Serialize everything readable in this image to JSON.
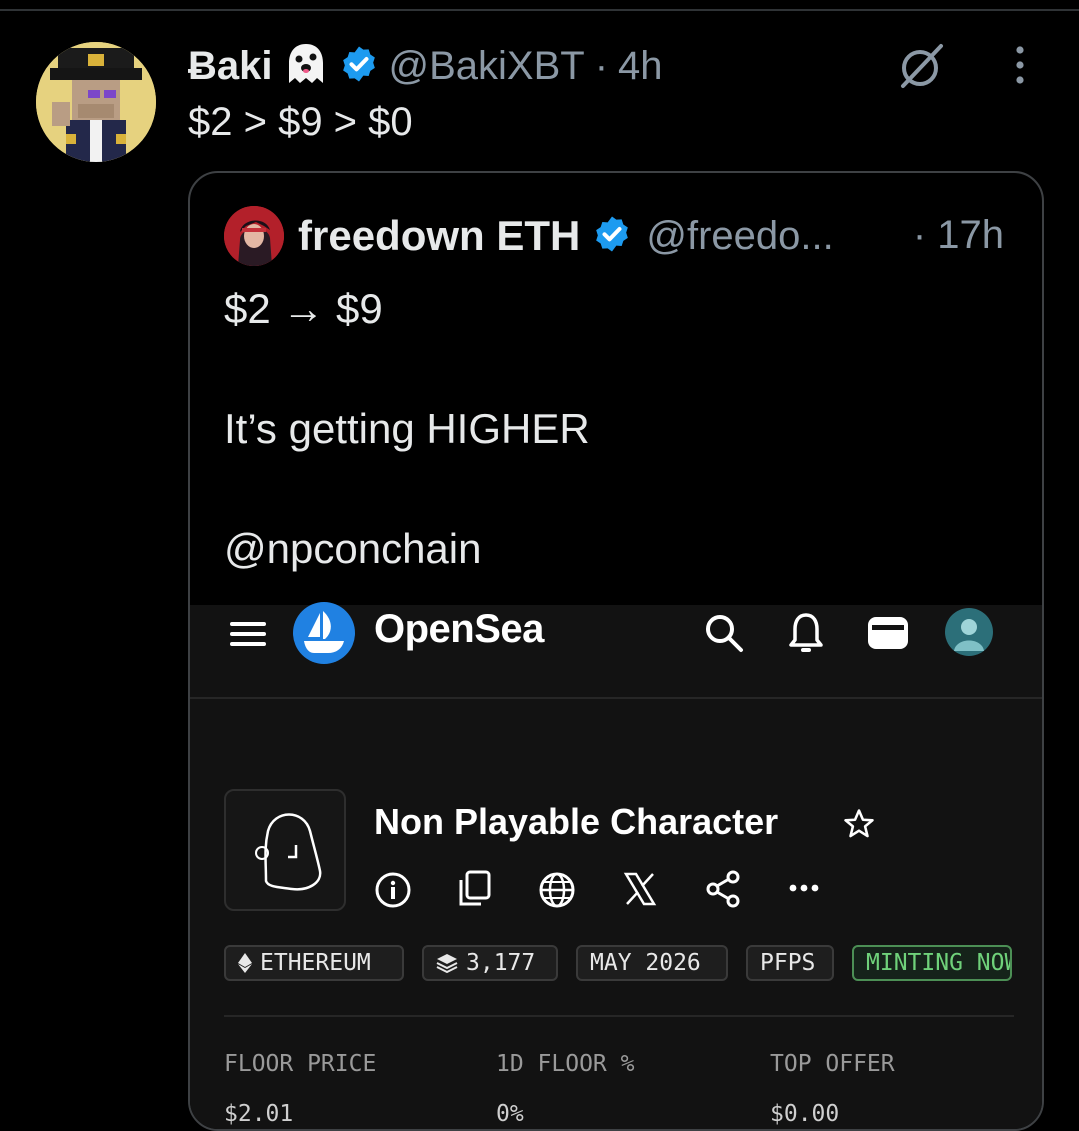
{
  "tweet": {
    "display_name": "Ƀaki",
    "handle": "@BakiXBT",
    "separator": "·",
    "time": "4h",
    "text": "$2 > $9 > $0"
  },
  "quote": {
    "display_name": "freedown ETH",
    "handle": "@freedo...",
    "time": "· 17h",
    "line1": "$2 → $9",
    "line2": "It’s getting HIGHER",
    "line3": "@npconchain"
  },
  "opensea": {
    "brand": "OpenSea",
    "collection_title": "Non Playable Character",
    "chips": [
      {
        "label": "ETHEREUM",
        "icon": "ethereum-icon"
      },
      {
        "label": "3,177",
        "icon": "layers-icon"
      },
      {
        "label": "MAY 2026"
      },
      {
        "label": "PFPS"
      },
      {
        "label": "MINTING NOW"
      }
    ],
    "stats": [
      {
        "label": "FLOOR PRICE",
        "value": "$2.01"
      },
      {
        "label": "1D FLOOR %",
        "value": "0%"
      },
      {
        "label": "TOP OFFER",
        "value": "$0.00"
      }
    ]
  },
  "colors": {
    "background": "#000000",
    "verified": "#1d9bf0",
    "opensea_blue": "#2081e2",
    "minting_green": "#6fd17a"
  }
}
